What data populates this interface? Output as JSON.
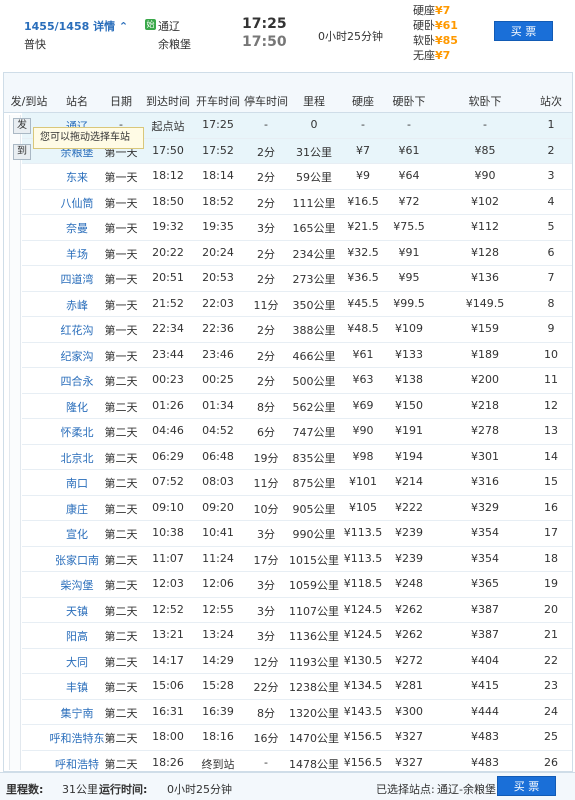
{
  "train": {
    "code": "1455/1458",
    "detail_label": "详情 ⌃",
    "type": "普快",
    "start_badge": "始",
    "from_station": "通辽",
    "to_station": "余粮堡",
    "dep_time": "17:25",
    "arr_time": "17:50",
    "duration": "0小时25分钟",
    "prices": [
      {
        "label": "硬座",
        "value": "¥7"
      },
      {
        "label": "硬卧",
        "value": "¥61"
      },
      {
        "label": "软卧",
        "value": "¥85"
      },
      {
        "label": "无座",
        "value": "¥7"
      }
    ],
    "buy_label": "买 票"
  },
  "table": {
    "headers": [
      "发/到站",
      "站名",
      "日期",
      "到达时间",
      "开车时间",
      "停车时间",
      "里程",
      "硬座",
      "硬卧下",
      "软卧下",
      "站次"
    ],
    "tooltip": "您可以拖动选择车站",
    "btn_from": "发",
    "btn_to": "到",
    "rows": [
      [
        "通辽",
        "-",
        "起点站",
        "17:25",
        "-",
        "0",
        "-",
        "-",
        "-",
        "1"
      ],
      [
        "余粮堡",
        "第一天",
        "17:50",
        "17:52",
        "2分",
        "31公里",
        "¥7",
        "¥61",
        "¥85",
        "2"
      ],
      [
        "东来",
        "第一天",
        "18:12",
        "18:14",
        "2分",
        "59公里",
        "¥9",
        "¥64",
        "¥90",
        "3"
      ],
      [
        "八仙筒",
        "第一天",
        "18:50",
        "18:52",
        "2分",
        "111公里",
        "¥16.5",
        "¥72",
        "¥102",
        "4"
      ],
      [
        "奈曼",
        "第一天",
        "19:32",
        "19:35",
        "3分",
        "165公里",
        "¥21.5",
        "¥75.5",
        "¥112",
        "5"
      ],
      [
        "羊场",
        "第一天",
        "20:22",
        "20:24",
        "2分",
        "234公里",
        "¥32.5",
        "¥91",
        "¥128",
        "6"
      ],
      [
        "四道湾",
        "第一天",
        "20:51",
        "20:53",
        "2分",
        "273公里",
        "¥36.5",
        "¥95",
        "¥136",
        "7"
      ],
      [
        "赤峰",
        "第一天",
        "21:52",
        "22:03",
        "11分",
        "350公里",
        "¥45.5",
        "¥99.5",
        "¥149.5",
        "8"
      ],
      [
        "红花沟",
        "第一天",
        "22:34",
        "22:36",
        "2分",
        "388公里",
        "¥48.5",
        "¥109",
        "¥159",
        "9"
      ],
      [
        "纪家沟",
        "第一天",
        "23:44",
        "23:46",
        "2分",
        "466公里",
        "¥61",
        "¥133",
        "¥189",
        "10"
      ],
      [
        "四合永",
        "第二天",
        "00:23",
        "00:25",
        "2分",
        "500公里",
        "¥63",
        "¥138",
        "¥200",
        "11"
      ],
      [
        "隆化",
        "第二天",
        "01:26",
        "01:34",
        "8分",
        "562公里",
        "¥69",
        "¥150",
        "¥218",
        "12"
      ],
      [
        "怀柔北",
        "第二天",
        "04:46",
        "04:52",
        "6分",
        "747公里",
        "¥90",
        "¥191",
        "¥278",
        "13"
      ],
      [
        "北京北",
        "第二天",
        "06:29",
        "06:48",
        "19分",
        "835公里",
        "¥98",
        "¥194",
        "¥301",
        "14"
      ],
      [
        "南口",
        "第二天",
        "07:52",
        "08:03",
        "11分",
        "875公里",
        "¥101",
        "¥214",
        "¥316",
        "15"
      ],
      [
        "康庄",
        "第二天",
        "09:10",
        "09:20",
        "10分",
        "905公里",
        "¥105",
        "¥222",
        "¥329",
        "16"
      ],
      [
        "宣化",
        "第二天",
        "10:38",
        "10:41",
        "3分",
        "990公里",
        "¥113.5",
        "¥239",
        "¥354",
        "17"
      ],
      [
        "张家口南",
        "第二天",
        "11:07",
        "11:24",
        "17分",
        "1015公里",
        "¥113.5",
        "¥239",
        "¥354",
        "18"
      ],
      [
        "柴沟堡",
        "第二天",
        "12:03",
        "12:06",
        "3分",
        "1059公里",
        "¥118.5",
        "¥248",
        "¥365",
        "19"
      ],
      [
        "天镇",
        "第二天",
        "12:52",
        "12:55",
        "3分",
        "1107公里",
        "¥124.5",
        "¥262",
        "¥387",
        "20"
      ],
      [
        "阳高",
        "第二天",
        "13:21",
        "13:24",
        "3分",
        "1136公里",
        "¥124.5",
        "¥262",
        "¥387",
        "21"
      ],
      [
        "大同",
        "第二天",
        "14:17",
        "14:29",
        "12分",
        "1193公里",
        "¥130.5",
        "¥272",
        "¥404",
        "22"
      ],
      [
        "丰镇",
        "第二天",
        "15:06",
        "15:28",
        "22分",
        "1238公里",
        "¥134.5",
        "¥281",
        "¥415",
        "23"
      ],
      [
        "集宁南",
        "第二天",
        "16:31",
        "16:39",
        "8分",
        "1320公里",
        "¥143.5",
        "¥300",
        "¥444",
        "24"
      ],
      [
        "呼和浩特东",
        "第二天",
        "18:00",
        "18:16",
        "16分",
        "1470公里",
        "¥156.5",
        "¥327",
        "¥483",
        "25"
      ],
      [
        "呼和浩特",
        "第二天",
        "18:26",
        "终到站",
        "-",
        "1478公里",
        "¥156.5",
        "¥327",
        "¥483",
        "26"
      ]
    ]
  },
  "footer": {
    "mileage_label": "里程数:",
    "mileage_value": "31公里",
    "runtime_label": "运行时间:",
    "runtime_value": "0小时25分钟",
    "selected_label": "已选择站点:",
    "selected_value": "通辽-余粮堡",
    "buy_label": "买 票"
  },
  "colors": {
    "accent": "#1a6fd8",
    "price": "#ff9900",
    "link": "#2a6ebb",
    "selected_row": "#e8f5fa"
  }
}
